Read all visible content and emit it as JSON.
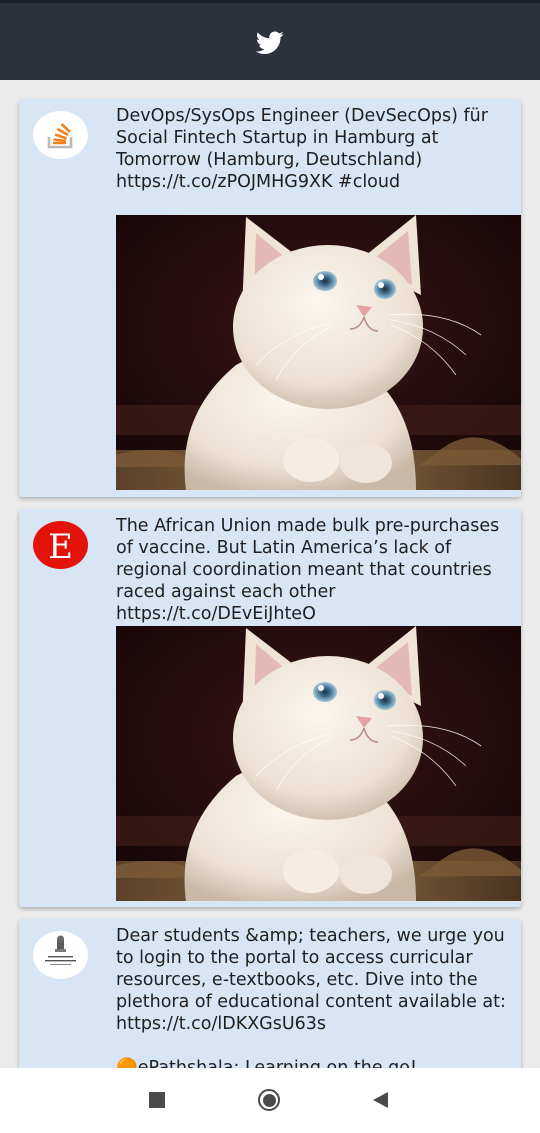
{
  "header": {
    "logo_icon": "twitter-bird-icon",
    "brand_color": "#ffffff",
    "bar_color": "#2d333d"
  },
  "tweets": [
    {
      "avatar_icon": "stackoverflow-logo-icon",
      "text": "DevOps/SysOps Engineer (DevSecOps) für Social Fintech Startup in Hamburg at Tomorrow (Hamburg, Deutschland) https://t.co/zPOJMHG9XK #cloud",
      "media": "kitten-photo"
    },
    {
      "avatar_icon": "economist-e-logo-icon",
      "text": "The African Union made bulk pre-purchases of vaccine. But Latin America’s lack of regional coordination meant that countries raced against each other https://t.co/DEvEiJhteO",
      "media": "kitten-photo"
    },
    {
      "avatar_icon": "ministry-of-education-emblem-icon",
      "text": "Dear students &amp; teachers, we urge you to login to the portal to access curricular resources, e-textbooks, etc. Dive into the plethora of educational content available at: https://t.co/lDKXGsU63s\n\n🟠ePathshala: Learning on the go!"
    }
  ],
  "navigation": {
    "recents_icon": "square-icon",
    "home_icon": "circle-icon",
    "back_icon": "triangle-back-icon"
  }
}
